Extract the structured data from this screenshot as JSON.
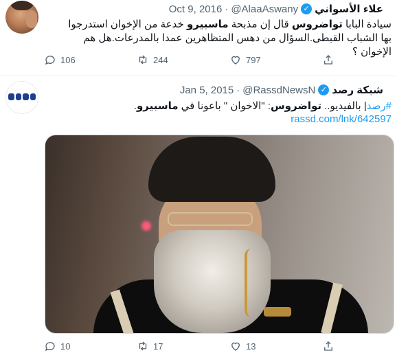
{
  "tweets": [
    {
      "name": "علاء الأسواني",
      "handle": "@AlaaAswany",
      "separator": "·",
      "date": "Oct 9, 2016",
      "text_parts": {
        "p1": "سيادة البابا ",
        "p2": "تواضروس",
        "p3": " قال إن مذبحة ",
        "p4": "ماسبيرو",
        "p5": " خدعة من الإخوان استدرجوا بها الشباب القبطى.السؤال من دهس المتظاهرين عمدا بالمدرعات.هل هم الإخوان ؟"
      },
      "actions": {
        "replies": "106",
        "retweets": "244",
        "likes": "797"
      }
    },
    {
      "name": "شبكة رصد",
      "handle": "@RassdNewsN",
      "separator": "·",
      "date": "Jan 5, 2015",
      "text_parts": {
        "hashtag": "#رصد",
        "p1": "| بالفيديو.. ",
        "p2": "تواضروس",
        "p3": ": \"الاخوان \" باعونا في ",
        "p4": "ماسبيرو",
        "p5": "."
      },
      "url": "rassd.com/lnk/642597",
      "actions": {
        "replies": "10",
        "retweets": "17",
        "likes": "13"
      }
    }
  ],
  "icons": {
    "reply": "speech-bubble-icon",
    "retweet": "retweet-arrows-icon",
    "like": "heart-icon",
    "share": "share-icon",
    "verified": "verified-badge-icon",
    "more": "chevron-down-icon"
  },
  "colors": {
    "accent": "#1d9bf0",
    "text": "#0f1419",
    "secondary": "#536471",
    "border": "#eff3f4"
  }
}
